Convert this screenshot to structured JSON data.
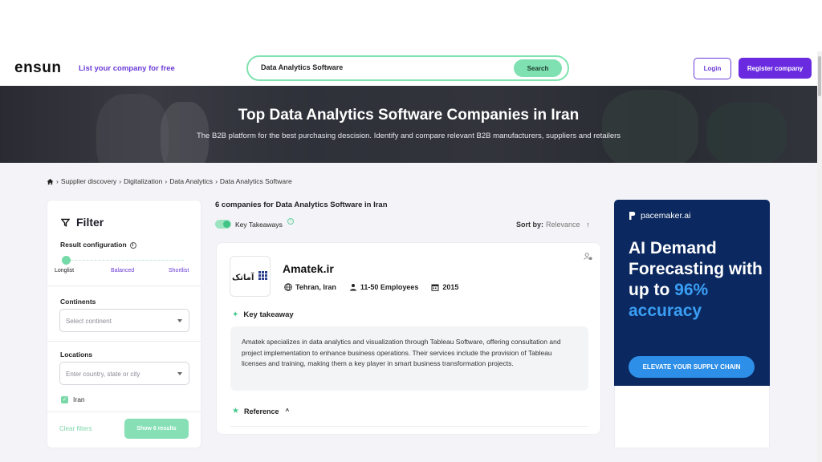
{
  "header": {
    "logo": "ensun",
    "list_company": "List your company for free",
    "search_value": "Data Analytics Software",
    "search_button": "Search",
    "login": "Login",
    "register": "Register company"
  },
  "hero": {
    "title": "Top Data Analytics Software Companies in Iran",
    "subtitle": "The B2B platform for the best purchasing descision. Identify and compare relevant B2B manufacturers, suppliers and retailers"
  },
  "breadcrumb": [
    "Supplier discovery",
    "Digitalization",
    "Data Analytics",
    "Data Analytics Software"
  ],
  "filter": {
    "title": "Filter",
    "result_config": "Result configuration",
    "slider_labels": [
      "Longlist",
      "Balanced",
      "Shortlist"
    ],
    "continents_label": "Continents",
    "continents_placeholder": "Select continent",
    "locations_label": "Locations",
    "locations_placeholder": "Enter country, state or city",
    "checked_location": "Iran",
    "clear": "Clear filters",
    "show": "Show 6 results"
  },
  "results": {
    "count_text": "6 companies for Data Analytics Software in Iran",
    "key_takeaways": "Key Takeaways",
    "sort_label": "Sort by:",
    "sort_value": "Relevance"
  },
  "company": {
    "name": "Amatek.ir",
    "location": "Tehran, Iran",
    "employees": "11-50 Employees",
    "founded": "2015",
    "key_takeaway_heading": "Key takeaway",
    "description": "Amatek specializes in data analytics and visualization through Tableau Software, offering consultation and project implementation to enhance business operations. Their services include the provision of Tableau licenses and training, making them a key player in smart business transformation projects.",
    "reference": "Reference",
    "logo_text": "آماتک"
  },
  "ad": {
    "brand": "pacemaker.ai",
    "headline_1": "AI Demand Forecasting with up to",
    "headline_accent": "96% accuracy",
    "cta": "ELEVATE YOUR SUPPLY CHAIN"
  },
  "colors": {
    "brand_purple": "#6a2be0",
    "accent_green": "#7fe0b1",
    "ad_navy": "#0b2960",
    "ad_blue": "#2e8fe8"
  }
}
